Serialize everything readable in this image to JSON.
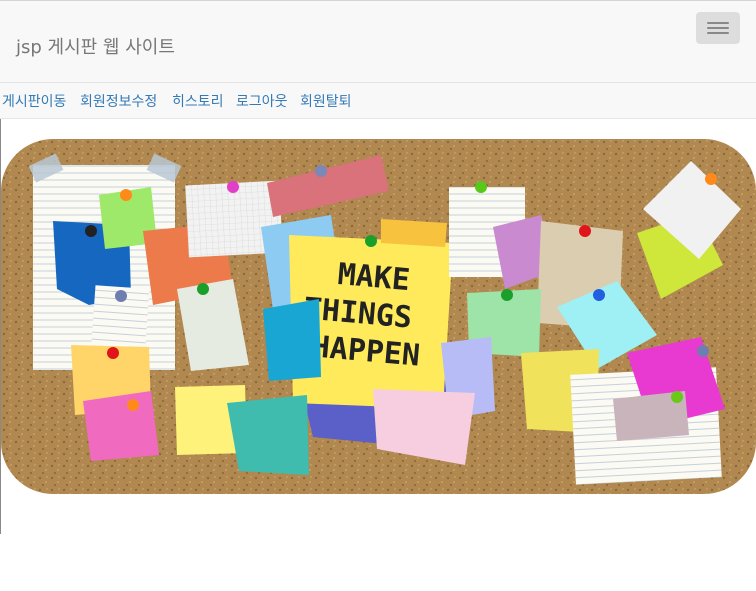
{
  "navbar": {
    "brand": "jsp 게시판 웹 사이트",
    "toggle_icon": "hamburger-menu-icon"
  },
  "nav_links": [
    {
      "label": "게시판이동"
    },
    {
      "label": "회원정보수정"
    },
    {
      "label": "히스토리"
    },
    {
      "label": "로그아웃"
    },
    {
      "label": "회원탈퇴"
    }
  ],
  "hero": {
    "note_text": [
      "MAKE",
      "THINGS",
      "HAPPEN"
    ]
  },
  "colors": {
    "link": "#337ab7",
    "brand": "#777777",
    "cork": "#b08850"
  }
}
